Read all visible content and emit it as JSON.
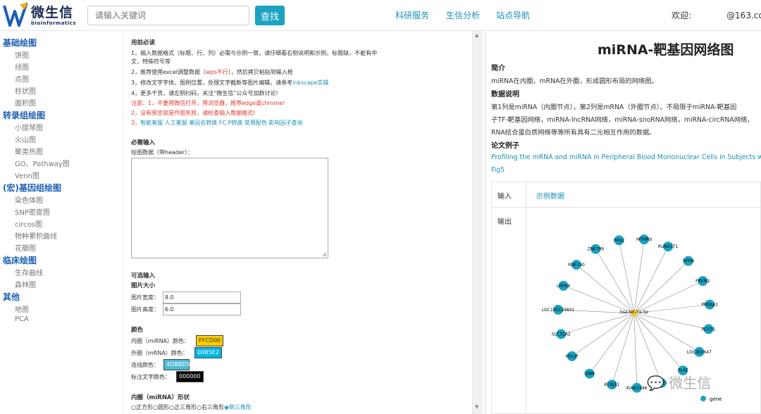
{
  "header": {
    "logo_text": "微生信",
    "logo_sub": "bioinformatics",
    "search_placeholder": "请输入关键词",
    "search_button": "查找",
    "nav": [
      "科研服务",
      "生信分析",
      "站点导航"
    ],
    "welcome_prefix": "欢迎:",
    "welcome_suffix": "@163.com,"
  },
  "sidebar": {
    "groups": [
      {
        "title": "基础绘图",
        "items": [
          "饼图",
          "线图",
          "点图",
          "柱状图",
          "面积图"
        ]
      },
      {
        "title": "转录组绘图",
        "items": [
          "小提琴图",
          "火山图",
          "聚类热图",
          "GO、Pathway图",
          "Venn图"
        ]
      },
      {
        "title": "(宏)基因组绘图",
        "items": [
          "染色体图",
          "SNP密度图",
          "circos图",
          "物种累积曲线",
          "花瓣图"
        ]
      },
      {
        "title": "临床绘图",
        "items": [
          "生存曲线",
          "森林图"
        ]
      },
      {
        "title": "其他",
        "items": [
          "地图",
          "PCA"
        ]
      }
    ]
  },
  "form": {
    "notice_title": "用前必读",
    "notice_1a": "1，输入数据格式（标题、行、列）必需与示例一致，请仔细看右侧说明和示例，标题缺，不能有中",
    "notice_1b": "文，特殊符号等",
    "notice_2_pre": "2，推荐使用excel调整数据（",
    "notice_2_red": "wps不行",
    "notice_2_post": "），然后拷贝粘贴到输入框",
    "notice_3_pre": "3，修改文字字体，图例位置，处理文字截断等图片编辑，请参考",
    "notice_3_link": "inkscape实操",
    "notice_4": "4，更多干货，请左侧扫码，关注“微生信”公众号加群讨论!",
    "warn_1": "注意：1，不要用微信打开，用浏览器，推荐edge或chrome!",
    "warn_2": "2，没有预览就是作图失败，请检查输入数据格式!",
    "warn_3_pre": "3，",
    "warn_3_links": "智能客服  人工客服  基因名转换  FC.P转换  常用配色  影响因子查询",
    "required_title": "必需输入",
    "data_label": "绘图数据（带header）：",
    "optional_title": "可选输入",
    "size_title": "图片大小",
    "width_label": "图片宽度：",
    "width_value": "8.0",
    "height_label": "图片高度：",
    "height_value": "6.0",
    "color_title": "颜色",
    "inner_color_label": "内圈（miRNA）颜色：",
    "inner_color": "FFCD00",
    "outer_color_label": "外圈（mRNA）颜色：",
    "outer_color": "00B5E2",
    "line_color_label": "连线颜色：",
    "line_color": "4DBBD5",
    "text_color_label": "标注文字颜色：",
    "text_color": "000000",
    "shape_title": "内圈（miRNA）形状",
    "shape_options": [
      "正方形",
      "圆形",
      "正三角形",
      "右三角形",
      "倒三角形"
    ]
  },
  "right": {
    "title": "miRNA-靶基因网络图",
    "intro_head": "简介",
    "intro_text": "miRNA在内圈，mRNA在外圈，形成圆形布局的网络图。",
    "data_head": "数据说明",
    "data_line1": "第1列是miRNA（内圈节点），第2列是mRNA（外圈节点）。不局限于miRNA-靶基因",
    "data_line2": "子TF-靶基因网络，miRNA-lncRNA网络，miRNA-snoRNA网络，miRNA-circRNA网络，",
    "data_line3": "RNA结合蛋白质网络等等所有具有二元相互作用的数据。",
    "paper_head": "论文例子",
    "paper_link": "Profiling the mRNA and miRNA in Peripheral Blood Mononuclear Cells in Subjects wit",
    "paper_fig": "Fig5",
    "input_label": "输入",
    "example_link": "示例数据",
    "output_label": "输出",
    "watermark": "微生信"
  },
  "network": {
    "center": "hsa-let-7a-5p",
    "nodes": [
      "PFN2",
      "MTMR9",
      "RUNX1T1",
      "SPRN",
      "FREM2",
      "PRKAA1",
      "RCC01",
      "LOC387647",
      "PLAT",
      "STX5",
      "KIAA1546",
      "KCNJ11",
      "GNN",
      "MYLIP",
      "SLC31A2",
      "LOC100133831",
      "LRFN4",
      "RNF150",
      "ZNF799"
    ],
    "legend": "gene",
    "colors": {
      "node": "#1aa3c2",
      "center": "#FFCD00",
      "edge": "#888888"
    }
  }
}
